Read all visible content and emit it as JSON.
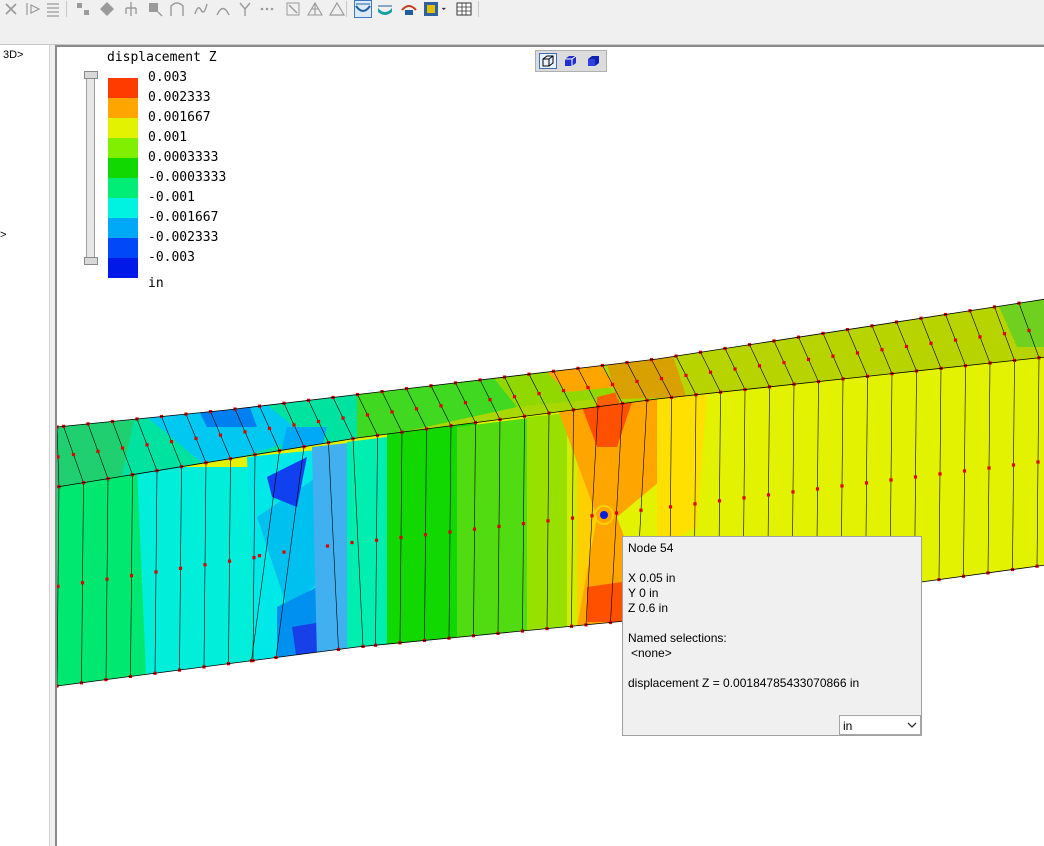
{
  "toolbar": {
    "buttons": [
      {
        "name": "delete-icon"
      },
      {
        "name": "mirror-icon"
      },
      {
        "name": "align-icon"
      },
      {
        "name": "node-select-icon"
      },
      {
        "name": "element-select-icon"
      },
      {
        "name": "support-icon"
      },
      {
        "name": "load-icon"
      },
      {
        "name": "arch-icon"
      },
      {
        "name": "spring-icon"
      },
      {
        "name": "curve-icon"
      },
      {
        "name": "branch-icon"
      },
      {
        "name": "dots-icon"
      },
      {
        "name": "arrow-box-icon"
      },
      {
        "name": "triangle-mesh-icon"
      },
      {
        "name": "triangle-icon"
      },
      {
        "name": "deformed-shape-icon"
      },
      {
        "name": "contour-icon"
      },
      {
        "name": "animation-icon"
      },
      {
        "name": "film-icon"
      },
      {
        "name": "table-icon"
      }
    ],
    "active_button": "deformed-shape-icon"
  },
  "left_panel": {
    "label_3d": "3D>",
    "label_arrow": ">"
  },
  "view_modes": [
    "wireframe-view-icon",
    "shaded-view-icon",
    "solid-view-icon"
  ],
  "legend": {
    "title": "displacement Z",
    "unit": "in",
    "entries": [
      {
        "label": "0.003",
        "color": "#ff3b00"
      },
      {
        "label": "0.002333",
        "color": "#ffa500"
      },
      {
        "label": "0.001667",
        "color": "#e2f200"
      },
      {
        "label": "0.001",
        "color": "#80f000"
      },
      {
        "label": "0.0003333",
        "color": "#10d800"
      },
      {
        "label": "-0.0003333",
        "color": "#00ee76"
      },
      {
        "label": "-0.001",
        "color": "#00f2e0"
      },
      {
        "label": "-0.001667",
        "color": "#00a8f8"
      },
      {
        "label": "-0.002333",
        "color": "#0048f8"
      },
      {
        "label": "-0.003",
        "color": "#0018e8"
      }
    ]
  },
  "tooltip": {
    "node": "Node  54",
    "x": "X  0.05 in",
    "y": "Y  0 in",
    "z": "Z  0.6 in",
    "named_title": "Named selections:",
    "named_value": "<none>",
    "result": "displacement Z = 0.00184785433070866 in",
    "unit_selected": "in"
  },
  "colors": {
    "node_marker": "#e00000",
    "selected_node": "#0020e0",
    "selection_ring": "#ffd000"
  }
}
